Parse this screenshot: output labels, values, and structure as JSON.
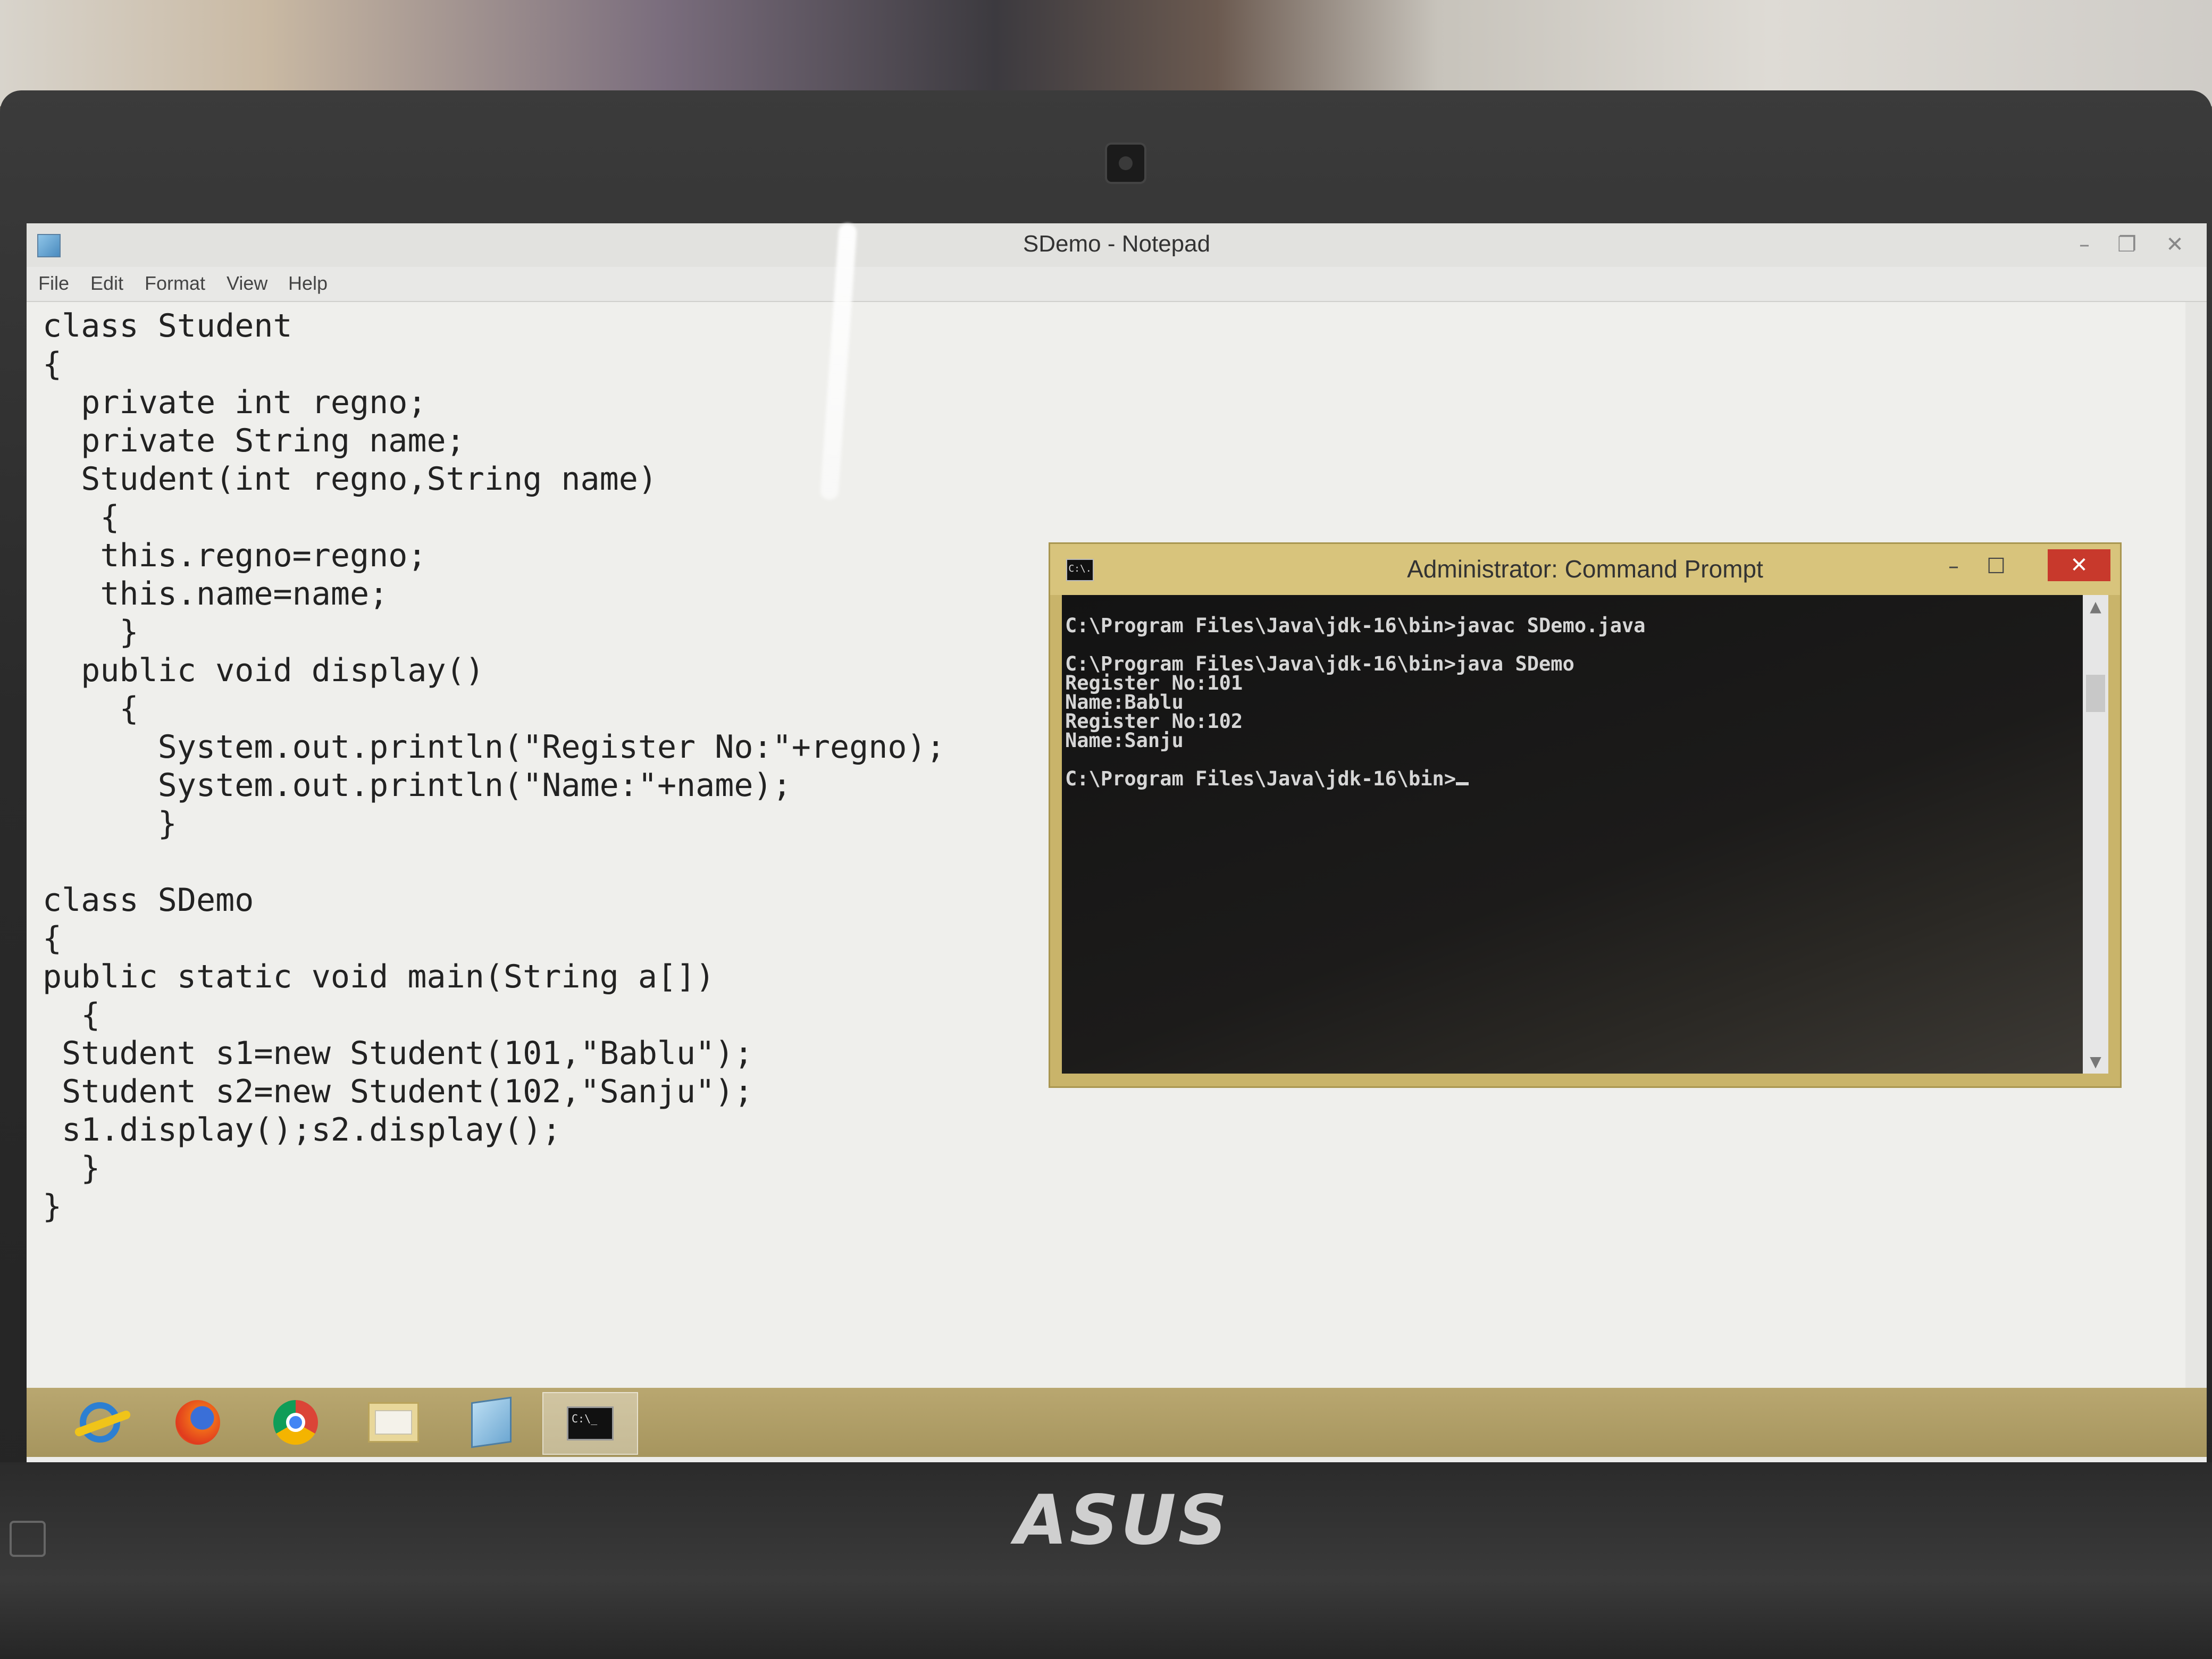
{
  "notepad": {
    "title": "SDemo - Notepad",
    "menu": [
      "File",
      "Edit",
      "Format",
      "View",
      "Help"
    ],
    "controls": [
      "–",
      "❐",
      "✕"
    ],
    "code": [
      "class Student",
      "{",
      "  private int regno;",
      "  private String name;",
      "  Student(int regno,String name)",
      "   {",
      "   this.regno=regno;",
      "   this.name=name;",
      "    }",
      "  public void display()",
      "    {",
      "      System.out.println(\"Register No:\"+regno);",
      "      System.out.println(\"Name:\"+name);",
      "      }",
      "",
      "class SDemo",
      "{",
      "public static void main(String a[])",
      "  {",
      " Student s1=new Student(101,\"Bablu\");",
      " Student s2=new Student(102,\"Sanju\");",
      " s1.display();s2.display();",
      "  }",
      "}"
    ]
  },
  "cmd": {
    "title": "Administrator: Command Prompt",
    "icon_text": "C:\\.",
    "controls": [
      "–",
      "☐",
      "✕"
    ],
    "lines": [
      "C:\\Program Files\\Java\\jdk-16\\bin>javac SDemo.java",
      "",
      "C:\\Program Files\\Java\\jdk-16\\bin>java SDemo",
      "Register No:101",
      "Name:Bablu",
      "Register No:102",
      "Name:Sanju",
      "",
      "C:\\Program Files\\Java\\jdk-16\\bin>"
    ]
  },
  "taskbar": {
    "items": [
      "internet-explorer-icon",
      "firefox-icon",
      "chrome-icon",
      "file-explorer-icon",
      "notepad-icon",
      "command-prompt-icon"
    ],
    "cmd_icon_text": "C:\\_"
  },
  "laptop": {
    "brand": "ASUS"
  }
}
